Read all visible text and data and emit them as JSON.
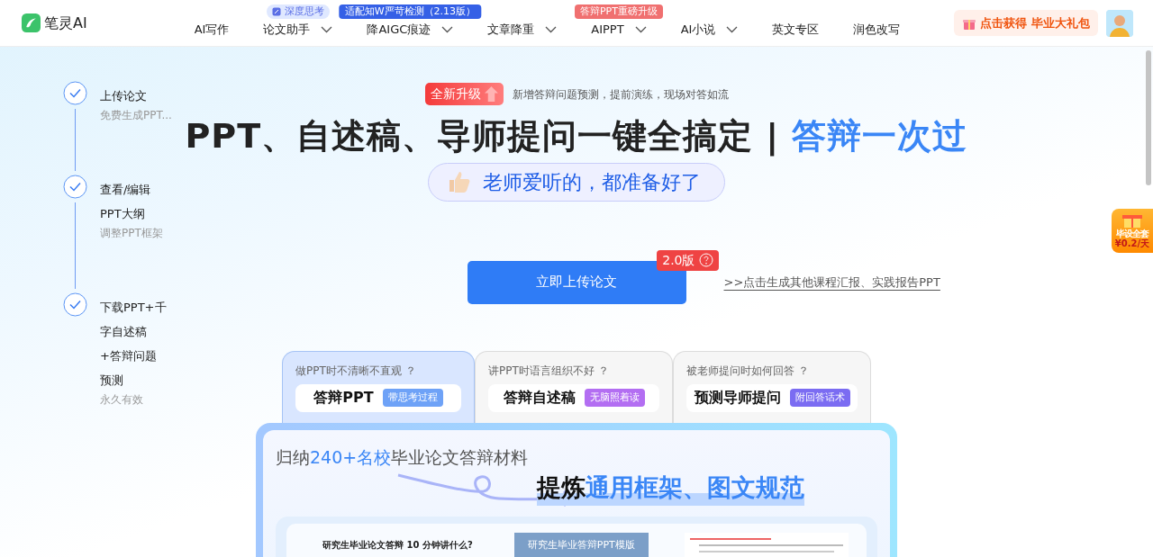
{
  "logo": {
    "name": "笔灵AI"
  },
  "nav": [
    {
      "label": "AI写作",
      "dropdown": false
    },
    {
      "label": "论文助手",
      "dropdown": true,
      "badge": {
        "text": "深度思考",
        "kind": "soft"
      }
    },
    {
      "label": "降AIGC痕迹",
      "dropdown": true,
      "badge": {
        "text": "适配知W严苛检测（2.13版）",
        "kind": "blue"
      }
    },
    {
      "label": "文章降重",
      "dropdown": true
    },
    {
      "label": "AIPPT",
      "dropdown": true,
      "badge": {
        "text": "答辩PPT重磅升级",
        "kind": "red"
      }
    },
    {
      "label": "AI小说",
      "dropdown": true
    },
    {
      "label": "英文专区",
      "dropdown": false
    },
    {
      "label": "润色改写",
      "dropdown": false
    }
  ],
  "promo_button": {
    "label": "点击获得 毕业大礼包"
  },
  "steps": [
    {
      "title": "上传论文",
      "note": "免费生成PPT...",
      "done": true
    },
    {
      "title": "查看/编辑PPT大纲",
      "note": "调整PPT框架",
      "done": true
    },
    {
      "title": "下载PPT+千字自述稿+答辩问题预测",
      "note": "永久有效",
      "done": true
    }
  ],
  "hero": {
    "tag": "全新升级",
    "tagline": "新增答辩问题预测，提前演练，现场对答如流",
    "headline": [
      {
        "text": "PPT、自述稿、导师提问一键全搞定 | ",
        "accent": false
      },
      {
        "text": "答辩一次过",
        "accent": true
      }
    ],
    "pill": "老师爱听的，都准备好了"
  },
  "upload_button": {
    "label": "立即上传论文",
    "version": "2.0版"
  },
  "other_link": ">>点击生成其他课程汇报、实践报告PPT",
  "cards": [
    {
      "question": "做PPT时不清晰不直观 ？",
      "title": "答辩PPT",
      "tag": "带思考过程",
      "color": "#6ea2f7",
      "selected": true
    },
    {
      "question": "讲PPT时语言组织不好 ？",
      "title": "答辩自述稿",
      "tag": "无脑照着读",
      "color": "#b36ef2",
      "selected": false
    },
    {
      "question": "被老师提问时如何回答 ？",
      "title": "预测导师提问",
      "tag": "附回答话术",
      "color": "#7b6cf2",
      "selected": false
    }
  ],
  "panel": {
    "intro": [
      {
        "text": "归纳",
        "accent": false
      },
      {
        "text": "240+名校",
        "accent": true
      },
      {
        "text": "毕业论文答辩材料",
        "accent": false
      }
    ],
    "slogan": [
      {
        "text": "提炼",
        "accent": false
      },
      {
        "text": "通用框架、图文规范",
        "accent": true
      }
    ],
    "doc_title": "研究生毕业论文答辩 10 分钟讲什么?",
    "slide_title": "研究生毕业答辩PPT模版"
  },
  "side_gift": {
    "label": "毕设全套",
    "price": "¥0.2/天"
  }
}
